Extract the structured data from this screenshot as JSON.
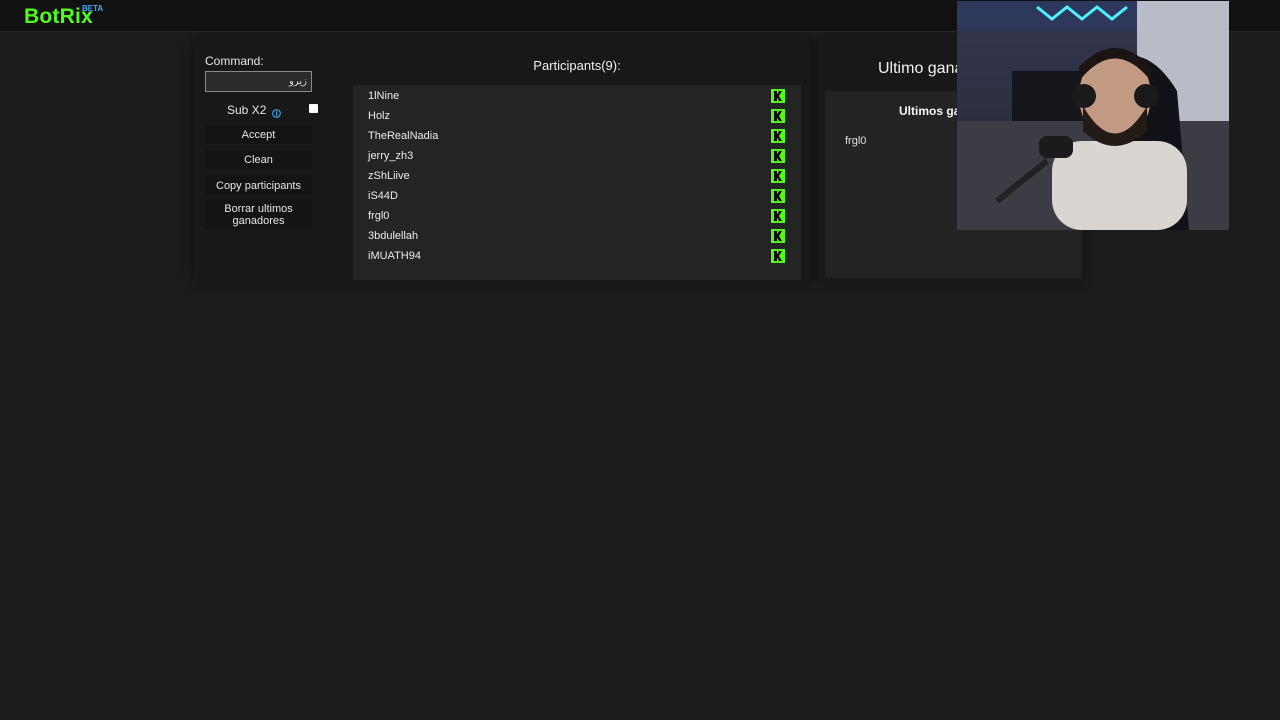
{
  "header": {
    "logo": "BotRix",
    "logo_badge": "BETA"
  },
  "controls": {
    "command_label": "Command:",
    "command_value": "زيرو",
    "sub_label": "Sub X2",
    "sub_checked": false,
    "buttons": {
      "accept": "Accept",
      "clean": "Clean",
      "copy": "Copy participants",
      "borrar": "Borrar ultimos ganadores"
    }
  },
  "participants": {
    "title": "Participants(9):",
    "items": [
      {
        "name": "1lNine",
        "platform_icon": "kick-icon"
      },
      {
        "name": "Holz",
        "platform_icon": "kick-icon"
      },
      {
        "name": "TheRealNadia",
        "platform_icon": "kick-icon"
      },
      {
        "name": "jerry_zh3",
        "platform_icon": "kick-icon"
      },
      {
        "name": "zShLiive",
        "platform_icon": "kick-icon"
      },
      {
        "name": "iS44D",
        "platform_icon": "kick-icon"
      },
      {
        "name": "frgl0",
        "platform_icon": "kick-icon"
      },
      {
        "name": "3bdulellah",
        "platform_icon": "kick-icon"
      },
      {
        "name": "iMUATH94",
        "platform_icon": "kick-icon"
      }
    ]
  },
  "winners": {
    "title": "Ultimo gana",
    "box_title": "Ultimos ga",
    "items": [
      "frgl0"
    ]
  },
  "colors": {
    "brand": "#53fc18",
    "badge": "#3fa9f5",
    "info": "#3fa9f5",
    "background": "#1c1c1c"
  }
}
